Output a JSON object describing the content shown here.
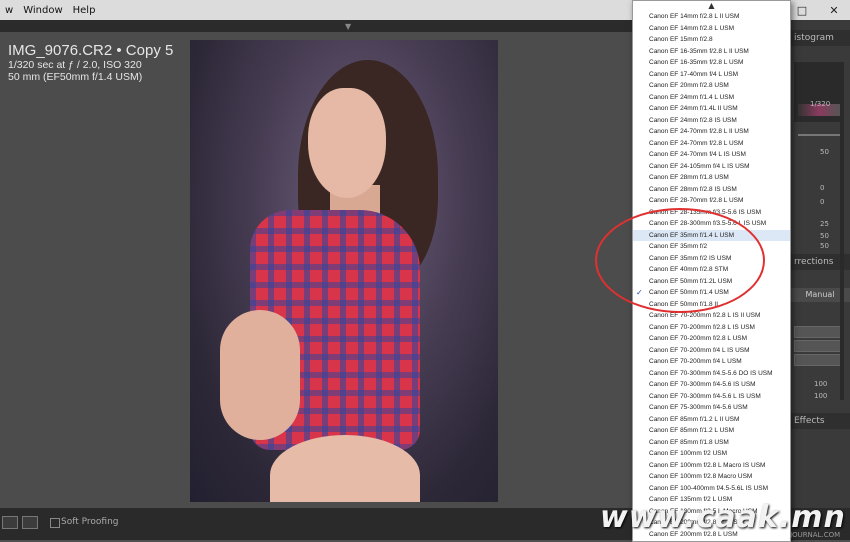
{
  "menu": {
    "items": [
      "w",
      "Window",
      "Help"
    ]
  },
  "window_controls": {
    "minimize": "–",
    "maximize": "□",
    "close": "✕"
  },
  "photo_info": {
    "title": "IMG_9076.CR2 • Copy 5",
    "exposure": "1/320 sec at ƒ / 2.0, ISO 320",
    "lens": "50 mm (EF50mm f/1.4 USM)"
  },
  "right_panel": {
    "histogram_header": "istogram",
    "histo_right": "1/320",
    "corrections_header": "rrections",
    "manual_tab": "Manual",
    "effects_header": "Effects",
    "values": [
      "50",
      "0",
      "0",
      "25",
      "50",
      "50",
      "100",
      "100"
    ]
  },
  "bottom": {
    "soft_proofing": "Soft Proofing"
  },
  "watermark": {
    "text": "www.caak.mn",
    "small": "JOURNAL.COM"
  },
  "lens_dropdown": {
    "selected": "Canon EF 50mm f/1.4 USM",
    "highlighted": "Canon EF 35mm f/1.4 L USM",
    "items": [
      "Canon EF 14mm f/2.8 L II USM",
      "Canon EF 14mm f/2.8 L USM",
      "Canon EF 15mm f/2.8",
      "Canon EF 16-35mm f/2.8 L II USM",
      "Canon EF 16-35mm f/2.8 L USM",
      "Canon EF 17-40mm f/4 L USM",
      "Canon EF 20mm f/2.8 USM",
      "Canon EF 24mm f/1.4 L USM",
      "Canon EF 24mm f/1.4L II USM",
      "Canon EF 24mm f/2.8 IS USM",
      "Canon EF 24-70mm f/2.8 L II USM",
      "Canon EF 24-70mm f/2.8 L USM",
      "Canon EF 24-70mm f/4 L IS USM",
      "Canon EF 24-105mm f/4 L IS USM",
      "Canon EF 28mm f/1.8 USM",
      "Canon EF 28mm f/2.8 IS USM",
      "Canon EF 28-70mm f/2.8 L USM",
      "Canon EF 28-135mm f/3.5-5.6 IS USM",
      "Canon EF 28-300mm f/3.5-5.6 L IS USM",
      "Canon EF 35mm f/1.4 L USM",
      "Canon EF 35mm f/2",
      "Canon EF 35mm f/2 IS USM",
      "Canon EF 40mm f/2.8 STM",
      "Canon EF 50mm f/1.2L USM",
      "Canon EF 50mm f/1.4 USM",
      "Canon EF 50mm f/1.8 II",
      "Canon EF 70-200mm f/2.8 L IS II USM",
      "Canon EF 70-200mm f/2.8 L IS USM",
      "Canon EF 70-200mm f/2.8 L USM",
      "Canon EF 70-200mm f/4 L IS USM",
      "Canon EF 70-200mm f/4 L USM",
      "Canon EF 70-300mm f/4.5-5.6 DO IS USM",
      "Canon EF 70-300mm f/4-5.6 IS USM",
      "Canon EF 70-300mm f/4-5.6 L IS USM",
      "Canon EF 75-300mm f/4-5.6 USM",
      "Canon EF 85mm f/1.2 L II USM",
      "Canon EF 85mm f/1.2 L USM",
      "Canon EF 85mm f/1.8 USM",
      "Canon EF 100mm f/2 USM",
      "Canon EF 100mm f/2.8 L Macro IS USM",
      "Canon EF 100mm f/2.8 Macro USM",
      "Canon EF 100-400mm f/4.5-5.6L IS USM",
      "Canon EF 135mm f/2 L USM",
      "Canon EF 180mm f/3.5 L Macro USM",
      "Canon EF 200mm f/2.8 L II USM",
      "Canon EF 200mm f/2.8 L USM"
    ]
  }
}
